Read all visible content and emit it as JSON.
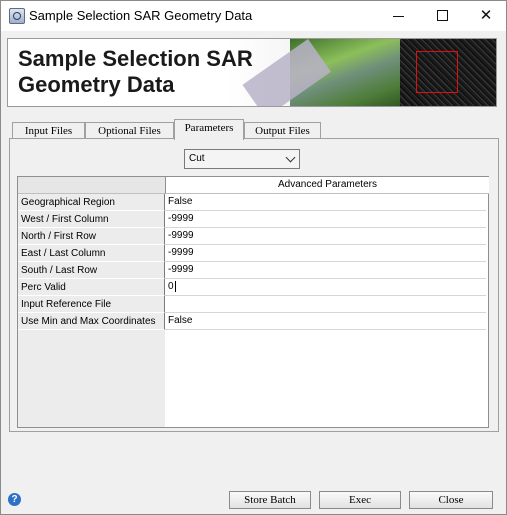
{
  "window": {
    "title": "Sample Selection SAR Geometry Data",
    "controls": [
      "minimize",
      "maximize",
      "close"
    ]
  },
  "banner": {
    "title_line1": "Sample Selection SAR",
    "title_line2": "Geometry Data"
  },
  "tabs": [
    {
      "label": "Input Files",
      "active": false
    },
    {
      "label": "Optional Files",
      "active": false
    },
    {
      "label": "Parameters",
      "active": true
    },
    {
      "label": "Output Files",
      "active": false
    }
  ],
  "mode_select": {
    "value": "Cut"
  },
  "table": {
    "header": "Advanced Parameters",
    "rows": [
      {
        "label": "Geographical Region",
        "value": "False"
      },
      {
        "label": "West / First Column",
        "value": "-9999"
      },
      {
        "label": "North / First Row",
        "value": "-9999"
      },
      {
        "label": "East / Last Column",
        "value": "-9999"
      },
      {
        "label": "South / Last Row",
        "value": "-9999"
      },
      {
        "label": "Perc Valid",
        "value": "0"
      },
      {
        "label": "Input Reference File",
        "value": ""
      },
      {
        "label": "Use Min and Max Coordinates",
        "value": "False"
      }
    ]
  },
  "footer": {
    "help_glyph": "?",
    "store_batch": "Store Batch",
    "exec": "Exec",
    "close": "Close"
  },
  "colors": {
    "help_icon": "#2f6fc5",
    "sar_box": "#e01010"
  }
}
